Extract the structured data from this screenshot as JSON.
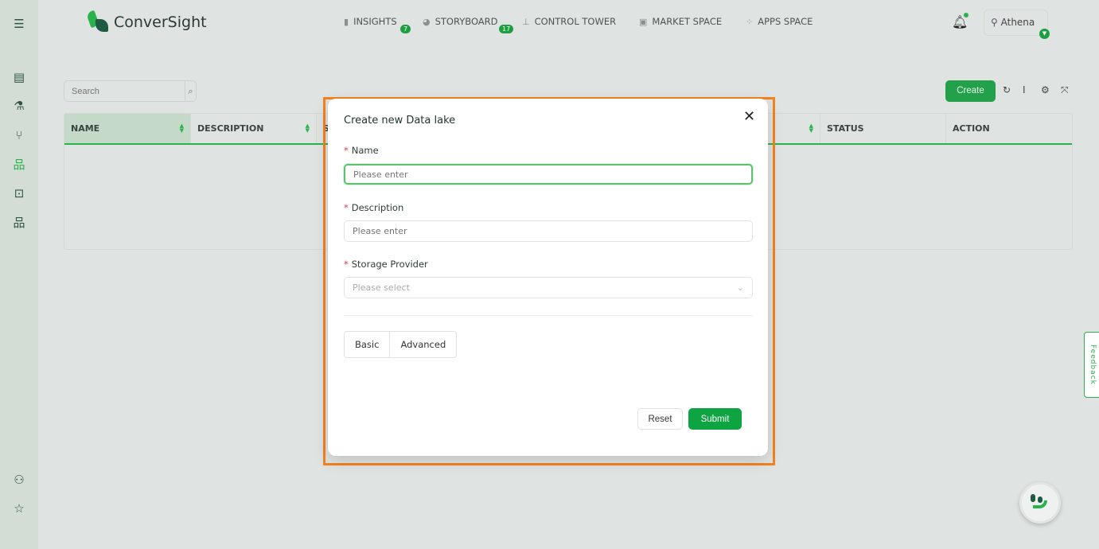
{
  "brand": {
    "name": "ConverSight"
  },
  "nav": [
    {
      "label": "INSIGHTS",
      "icon": "bar-chart-icon",
      "badge": "7"
    },
    {
      "label": "STORYBOARD",
      "icon": "storyboard-icon",
      "badge": "17"
    },
    {
      "label": "CONTROL TOWER",
      "icon": "control-tower-icon"
    },
    {
      "label": "MARKET SPACE",
      "icon": "market-icon"
    },
    {
      "label": "APPS SPACE",
      "icon": "apps-icon"
    }
  ],
  "user": {
    "name": "Athena"
  },
  "search": {
    "placeholder": "Search"
  },
  "toolbar": {
    "create": "Create"
  },
  "table": {
    "columns": [
      "NAME",
      "DESCRIPTION",
      "S",
      "",
      "STATUS",
      "ACTION"
    ]
  },
  "modal": {
    "title": "Create new Data lake",
    "name_label": "Name",
    "name_placeholder": "Please enter",
    "desc_label": "Description",
    "desc_placeholder": "Please enter",
    "storage_label": "Storage Provider",
    "storage_placeholder": "Please select",
    "required_mark": "*",
    "tabs": [
      "Basic",
      "Advanced"
    ],
    "reset": "Reset",
    "submit": "Submit"
  },
  "feedback": "Feedback",
  "colors": {
    "accent": "#22a04a",
    "highlight": "#f5821f"
  }
}
